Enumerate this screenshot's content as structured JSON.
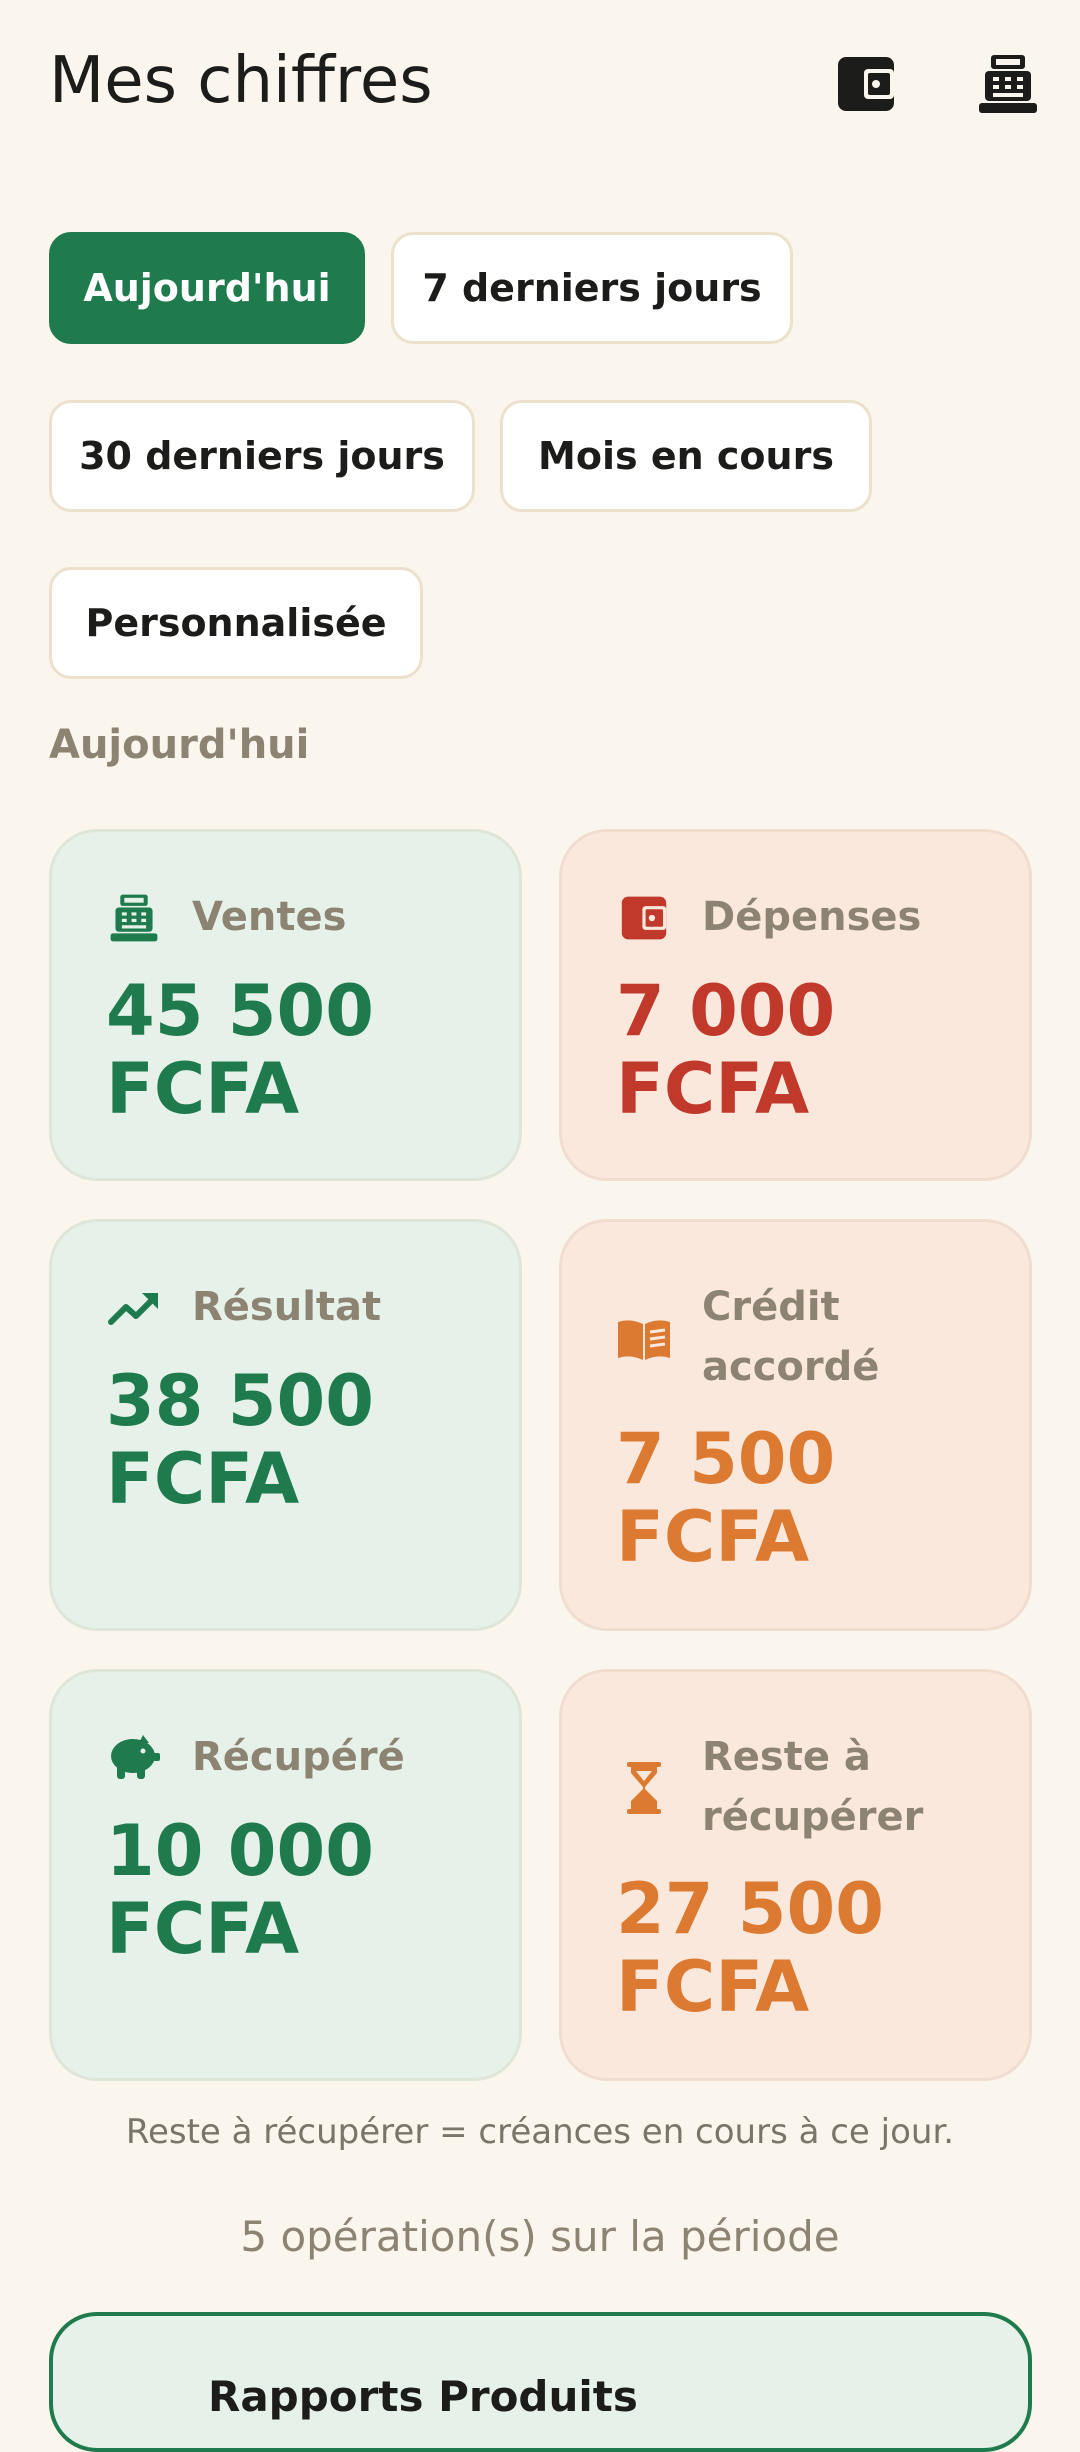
{
  "header": {
    "title": "Mes chiffres",
    "icons": [
      "wallet-icon",
      "cash-register-icon"
    ]
  },
  "filters": {
    "selected": "Aujourd'hui",
    "chips": [
      "Aujourd'hui",
      "7 derniers jours",
      "30 derniers jours",
      "Mois en cours",
      "Personnalisée"
    ]
  },
  "period_label": "Aujourd'hui",
  "cards": {
    "ventes": {
      "label": "Ventes",
      "value_line1": "45 500",
      "value_line2": "FCFA",
      "icon": "cash-register-icon"
    },
    "depenses": {
      "label": "Dépenses",
      "value_line1": "7 000",
      "value_line2": "FCFA",
      "icon": "wallet-icon"
    },
    "resultat": {
      "label": "Résultat",
      "value_line1": "38 500",
      "value_line2": "FCFA",
      "icon": "trending-up-icon"
    },
    "credit": {
      "label_line1": "Crédit",
      "label_line2": "accordé",
      "value_line1": "7 500",
      "value_line2": "FCFA",
      "icon": "open-book-icon"
    },
    "recupere": {
      "label": "Récupéré",
      "value_line1": "10 000",
      "value_line2": "FCFA",
      "icon": "piggy-bank-icon"
    },
    "reste": {
      "label_line1": "Reste à",
      "label_line2": "récupérer",
      "value_line1": "27 500",
      "value_line2": "FCFA",
      "icon": "hourglass-icon"
    }
  },
  "footnote": "Reste à récupérer = créances en cours à ce jour.",
  "operations_count": "5 opération(s) sur la période",
  "reports": {
    "title": "Rapports Produits"
  },
  "colors": {
    "background": "#faf6ee",
    "primary_green": "#1f7a4d",
    "expense_red": "#c0392b",
    "credit_orange": "#dd7a32",
    "card_green": "#e5f1e9",
    "card_peach": "#fbe8dc"
  }
}
